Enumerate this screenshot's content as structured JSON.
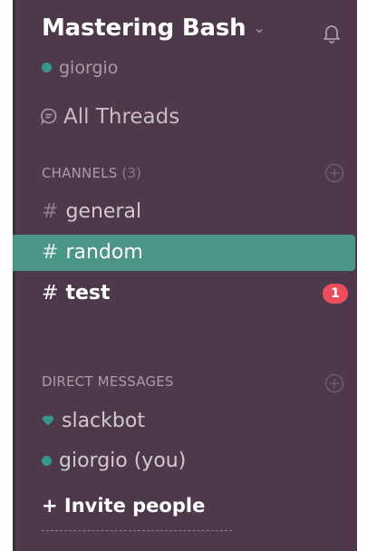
{
  "team": {
    "name": "Mastering Bash",
    "chevron": "⌄",
    "bell_icon": "bell-icon"
  },
  "user": {
    "name": "giorgio",
    "status": "online"
  },
  "nav": {
    "threads_label": "All Threads"
  },
  "channels": {
    "header": "CHANNELS",
    "count": "(3)",
    "items": [
      {
        "hash": "#",
        "name": "general",
        "state": "normal"
      },
      {
        "hash": "#",
        "name": "random",
        "state": "active"
      },
      {
        "hash": "#",
        "name": "test",
        "state": "unread",
        "badge": "1"
      }
    ]
  },
  "direct_messages": {
    "header": "DIRECT MESSAGES",
    "items": [
      {
        "name": "slackbot",
        "icon": "heart-icon"
      },
      {
        "name": "giorgio (you)",
        "icon": "presence-dot"
      }
    ]
  },
  "invite": {
    "label": "+ Invite people"
  },
  "colors": {
    "sidebar_bg": "#4d394b",
    "active_bg": "#4c9689",
    "presence": "#38978d",
    "badge": "#eb4d5c"
  }
}
